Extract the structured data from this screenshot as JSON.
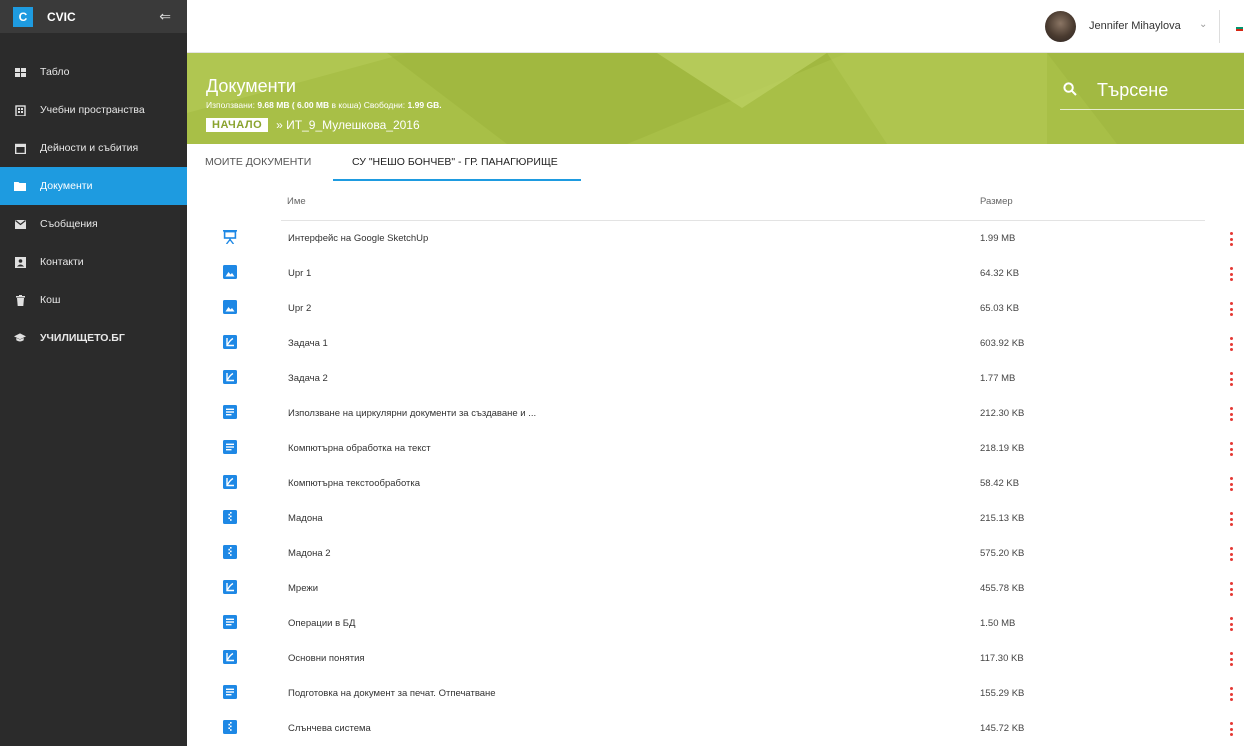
{
  "app": {
    "logo_letter": "C",
    "name": "CVIC"
  },
  "sidebar": {
    "items": [
      {
        "label": "Табло",
        "icon": "dashboard-icon"
      },
      {
        "label": "Учебни пространства",
        "icon": "building-icon"
      },
      {
        "label": "Дейности и събития",
        "icon": "calendar-icon"
      },
      {
        "label": "Документи",
        "icon": "folder-icon",
        "active": true
      },
      {
        "label": "Съобщения",
        "icon": "mail-icon"
      },
      {
        "label": "Контакти",
        "icon": "contact-card-icon"
      },
      {
        "label": "Кош",
        "icon": "trash-icon"
      },
      {
        "label": "УЧИЛИЩЕТО.БГ",
        "icon": "graduation-cap-icon"
      }
    ]
  },
  "user": {
    "name": "Jennifer Mihaylova"
  },
  "banner": {
    "title": "Документи",
    "used_label": "Използвани:",
    "used_value": "9.68 MB ( 6.00 MB",
    "trash_note": "в коша)",
    "free_label": "Свободни:",
    "free_value": "1.99 GB.",
    "crumb_home": "НАЧАЛО",
    "crumb_current": "» ИТ_9_Мулешкова_2016",
    "search_placeholder": "Търсене"
  },
  "tabs": [
    {
      "label": "МОИТЕ ДОКУМЕНТИ"
    },
    {
      "label": "СУ \"НЕШО БОНЧЕВ\" - ГР. ПАНАГЮРИЩЕ",
      "active": true
    }
  ],
  "table": {
    "headers": {
      "name": "Име",
      "size": "Размер"
    },
    "rows": [
      {
        "name": "Интерфейс на Google SketchUp",
        "size": "1.99 MB",
        "type": "presentation"
      },
      {
        "name": "Upr 1",
        "size": "64.32 KB",
        "type": "image"
      },
      {
        "name": "Upr 2",
        "size": "65.03 KB",
        "type": "image"
      },
      {
        "name": "Задача 1",
        "size": "603.92 KB",
        "type": "pdf"
      },
      {
        "name": "Задача 2",
        "size": "1.77 MB",
        "type": "pdf"
      },
      {
        "name": "Използване на циркулярни документи за създаване и ...",
        "size": "212.30 KB",
        "type": "document"
      },
      {
        "name": "Компютърна обработка на текст",
        "size": "218.19 KB",
        "type": "document"
      },
      {
        "name": "Компютърна текстообработка",
        "size": "58.42 KB",
        "type": "pdf"
      },
      {
        "name": "Мадона",
        "size": "215.13 KB",
        "type": "archive"
      },
      {
        "name": "Мадона 2",
        "size": "575.20 KB",
        "type": "archive"
      },
      {
        "name": "Мрежи",
        "size": "455.78 KB",
        "type": "pdf"
      },
      {
        "name": "Операции в БД",
        "size": "1.50 MB",
        "type": "document"
      },
      {
        "name": "Основни понятия",
        "size": "117.30 KB",
        "type": "pdf"
      },
      {
        "name": "Подготовка на документ за печат. Отпечатване",
        "size": "155.29 KB",
        "type": "document"
      },
      {
        "name": "Слънчева система",
        "size": "145.72 KB",
        "type": "archive"
      }
    ]
  },
  "colors": {
    "accent": "#1e9be0",
    "banner": "#a8bf47",
    "sidebar": "#2b2b2b",
    "menu_dots": "#e53935"
  }
}
